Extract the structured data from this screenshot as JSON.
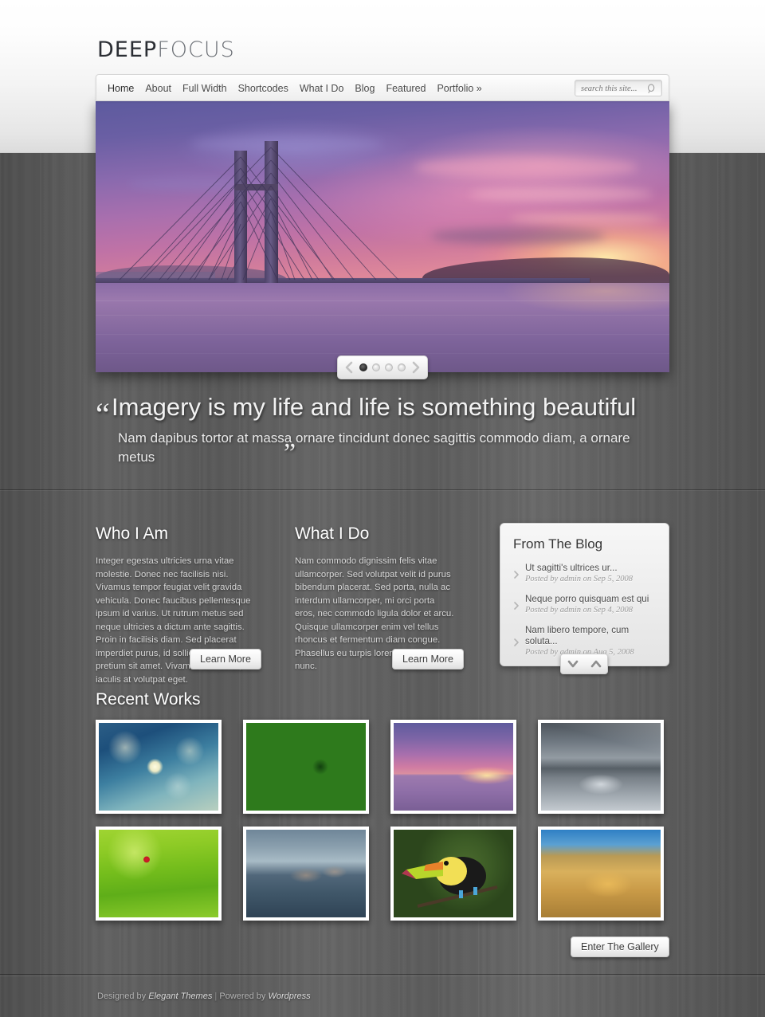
{
  "site": {
    "logo_deep": "DEEP",
    "logo_focus": "FOCUS"
  },
  "nav": {
    "items": [
      {
        "label": "Home",
        "active": true
      },
      {
        "label": "About",
        "active": false
      },
      {
        "label": "Full Width",
        "active": false
      },
      {
        "label": "Shortcodes",
        "active": false
      },
      {
        "label": "What I Do",
        "active": false
      },
      {
        "label": "Blog",
        "active": false
      },
      {
        "label": "Featured",
        "active": false
      },
      {
        "label": "Portfolio »",
        "active": false
      }
    ]
  },
  "search": {
    "placeholder": "search this site...",
    "value": "",
    "icon": "search-icon"
  },
  "slider": {
    "image_alt": "Suspension bridge over river at purple sunset",
    "dots": 4,
    "active_dot": 1,
    "prev_icon": "chevron-left-icon",
    "next_icon": "chevron-right-icon"
  },
  "quote": {
    "open_mark": "“",
    "headline": "Imagery is my life and life is something beautiful",
    "subtext": "Nam dapibus tortor at massa ornare tincidunt donec sagittis commodo diam, a ornare metus",
    "close_mark": "”"
  },
  "columns": [
    {
      "title": "Who I Am",
      "body": "Integer egestas ultricies urna vitae molestie. Donec nec facilisis nisi. Vivamus tempor feugiat velit gravida vehicula. Donec faucibus pellentesque ipsum id varius. Ut rutrum metus sed neque ultricies a dictum ante sagittis. Proin in facilisis diam. Sed placerat imperdiet purus, id sollicitudin magna pretium sit amet. Vivamus orci dolor, iaculis at volutpat eget.",
      "button": "Learn More"
    },
    {
      "title": "What I Do",
      "body": "Nam commodo dignissim felis vitae ullamcorper. Sed volutpat velit id purus bibendum placerat. Sed porta, nulla ac interdum ullamcorper, mi orci porta eros, nec commodo ligula dolor et arcu. Quisque ullamcorper enim vel tellus rhoncus et fermentum diam congue. Phasellus eu turpis lorem, id gravida nunc.",
      "button": "Learn More"
    }
  ],
  "blog_widget": {
    "title": "From The Blog",
    "posts": [
      {
        "title": "Ut sagitti's ultrices ur...",
        "meta": "Posted by admin on Sep 5, 2008"
      },
      {
        "title": "Neque porro quisquam est qui",
        "meta": "Posted by admin on Sep 4, 2008"
      },
      {
        "title": "Nam libero tempore, cum soluta...",
        "meta": "Posted by admin on Aug 5, 2008"
      }
    ],
    "bullet_icon": "chevron-right-icon",
    "down_icon": "chevron-down-icon",
    "up_icon": "chevron-up-icon"
  },
  "recent_works": {
    "title": "Recent Works",
    "thumbnails": [
      {
        "alt": "Dandelion seed head on blue background"
      },
      {
        "alt": "Green spiky plant with water droplets"
      },
      {
        "alt": "Bridge over river at purple sunset"
      },
      {
        "alt": "Gazebo at end of wooden pier, stormy sky"
      },
      {
        "alt": "Red ladybug on bright green leaves"
      },
      {
        "alt": "Snow monkeys bathing in hot spring"
      },
      {
        "alt": "Keel-billed toucan perched on a branch"
      },
      {
        "alt": "Golden wheat ears against blue sky"
      }
    ],
    "gallery_button": "Enter The Gallery"
  },
  "footer": {
    "designed_by": "Designed by",
    "designer": "Elegant Themes",
    "separator": "|",
    "powered_by": "Powered by",
    "platform": "Wordpress"
  },
  "colors": {
    "body_bg": "#5a5a5a",
    "header_bg": "#f4f4f4",
    "text_light": "#d8d8d8",
    "heading_white": "#ffffff",
    "button_face": "#f4f4f4"
  }
}
